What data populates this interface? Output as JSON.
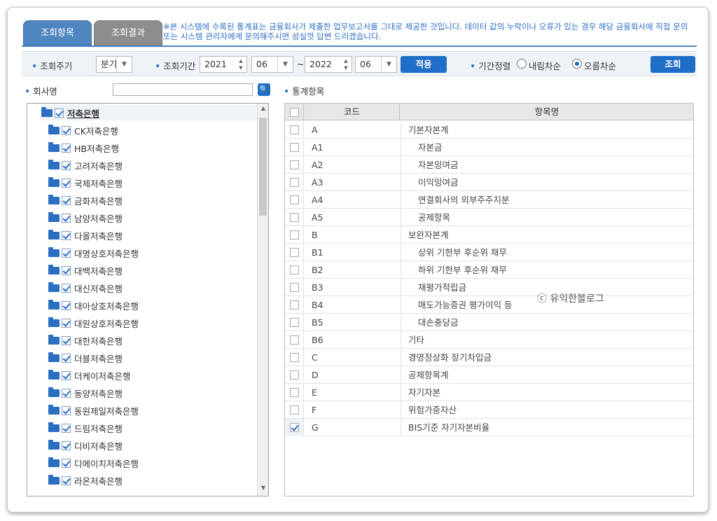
{
  "tabs": {
    "active": "조회항목",
    "inactive": "조회결과"
  },
  "notice": "※본 시스템에 수록된 통계표는 금융회사가 제출한 업무보고서를 그대로 제공한 것입니다. 데이터 값의 누락이나 오류가 있는 경우 해당 금융회사에 직접 문의 또는 시스템 관리자에게 문의해주시면 성실껏 답변 드리겠습니다.",
  "filter": {
    "period_label": "조회주기",
    "period_value": "분기",
    "range_label": "조회기간",
    "from_year": "2021",
    "from_month": "06",
    "tilde": "~",
    "to_year": "2022",
    "to_month": "06",
    "apply_button": "적용",
    "sort_label": "기간정렬",
    "sort_desc": "내림차순",
    "sort_asc": "오름차순",
    "sort_selected": "asc",
    "search_button": "조회"
  },
  "left": {
    "company_label": "회사명",
    "company_search_value": "",
    "root": "저축은행",
    "companies": [
      "CK저축은행",
      "HB저축은행",
      "고려저축은행",
      "국제저축은행",
      "금화저축은행",
      "남양저축은행",
      "다올저축은행",
      "대명상호저축은행",
      "대백저축은행",
      "대신저축은행",
      "대아상호저축은행",
      "대원상호저축은행",
      "대한저축은행",
      "더블저축은행",
      "더케이저축은행",
      "동양저축은행",
      "동원제일저축은행",
      "드림저축은행",
      "디비저축은행",
      "디에이치저축은행",
      "라온저축은행"
    ]
  },
  "right": {
    "stats_label": "통계항목",
    "col_code": "코드",
    "col_name": "항목명",
    "rows": [
      {
        "code": "A",
        "name": "기본자본계",
        "indent": false,
        "checked": false
      },
      {
        "code": "A1",
        "name": "자본금",
        "indent": true,
        "checked": false
      },
      {
        "code": "A2",
        "name": "자본잉여금",
        "indent": true,
        "checked": false
      },
      {
        "code": "A3",
        "name": "이익잉여금",
        "indent": true,
        "checked": false
      },
      {
        "code": "A4",
        "name": "연결회사의 외부주주지분",
        "indent": true,
        "checked": false
      },
      {
        "code": "A5",
        "name": "공제항목",
        "indent": true,
        "checked": false
      },
      {
        "code": "B",
        "name": "보완자본계",
        "indent": false,
        "checked": false
      },
      {
        "code": "B1",
        "name": "상위 기한부 후순위 채무",
        "indent": true,
        "checked": false
      },
      {
        "code": "B2",
        "name": "하위 기한부 후순위 채무",
        "indent": true,
        "checked": false
      },
      {
        "code": "B3",
        "name": "재평가적립금",
        "indent": true,
        "checked": false
      },
      {
        "code": "B4",
        "name": "매도가능증권 평가이익 등",
        "indent": true,
        "checked": false
      },
      {
        "code": "B5",
        "name": "대손충당금",
        "indent": true,
        "checked": false
      },
      {
        "code": "B6",
        "name": "기타",
        "indent": false,
        "checked": false
      },
      {
        "code": "C",
        "name": "경영정상화 장기차입금",
        "indent": false,
        "checked": false
      },
      {
        "code": "D",
        "name": "공제항목계",
        "indent": false,
        "checked": false
      },
      {
        "code": "E",
        "name": "자기자본",
        "indent": false,
        "checked": false
      },
      {
        "code": "F",
        "name": "위험가중자산",
        "indent": false,
        "checked": false
      },
      {
        "code": "G",
        "name": "BIS기준 자기자본비율",
        "indent": false,
        "checked": true
      }
    ]
  },
  "watermark": "ⓒ 유익한블로그",
  "colors": {
    "accent": "#1f6ec8",
    "tab_active": "#4f86c0",
    "tab_inactive": "#8d8d8d",
    "notice": "#2a6cc4"
  }
}
